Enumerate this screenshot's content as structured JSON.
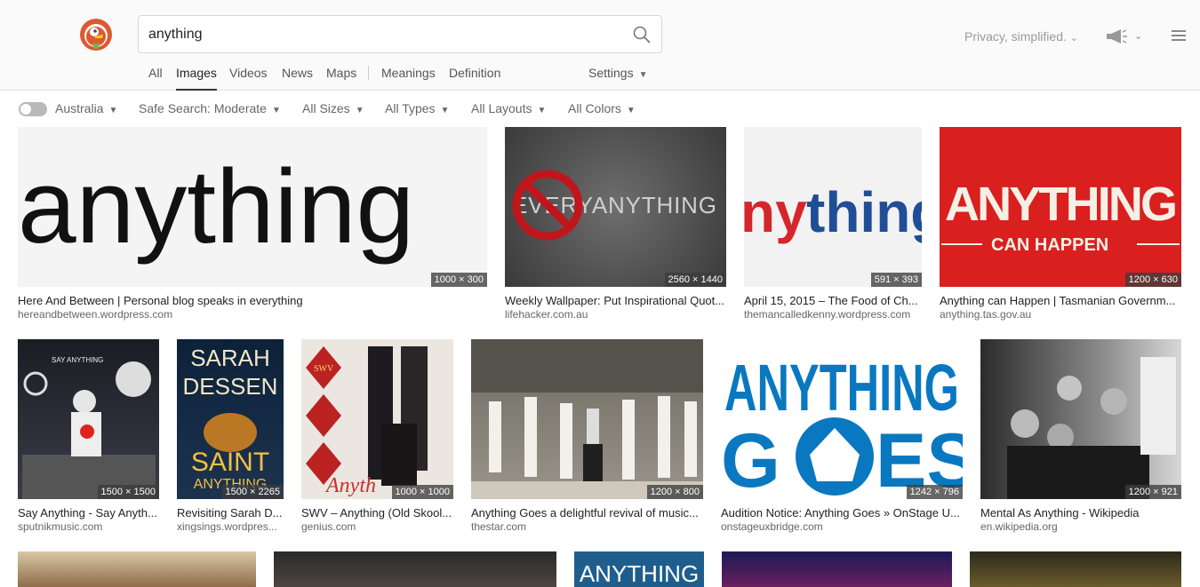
{
  "search": {
    "query": "anything"
  },
  "tabs": [
    "All",
    "Images",
    "Videos",
    "News",
    "Maps",
    "Meanings",
    "Definition"
  ],
  "settings_label": "Settings",
  "tagline": "Privacy, simplified.",
  "filters": {
    "region": "Australia",
    "safe_search": "Safe Search: Moderate",
    "sizes": "All Sizes",
    "types": "All Types",
    "layouts": "All Layouts",
    "colors": "All Colors"
  },
  "results": [
    {
      "title": "Here And Between | Personal blog speaks in everything",
      "source": "hereandbetween.wordpress.com",
      "dims": "1000 × 300",
      "thumb_text": "anything"
    },
    {
      "title": "Weekly Wallpaper: Put Inspirational Quot...",
      "source": "lifehacker.com.au",
      "dims": "2560 × 1440",
      "thumb_text": "EVERYANYTHING"
    },
    {
      "title": "April 15, 2015 – The Food of Ch...",
      "source": "themancalledkenny.wordpress.com",
      "dims": "591 × 393",
      "thumb_text_a": "ny",
      "thumb_text_b": "thing"
    },
    {
      "title": "Anything can Happen | Tasmanian Governm...",
      "source": "anything.tas.gov.au",
      "dims": "1200 × 630",
      "thumb_text_a": "ANYTHING",
      "thumb_text_b": "CAN HAPPEN"
    },
    {
      "title": "Say Anything - Say Anyth...",
      "source": "sputnikmusic.com",
      "dims": "1500 × 1500",
      "thumb_text": "SAY ANYTHING"
    },
    {
      "title": "Revisiting Sarah D...",
      "source": "xingsings.wordpres...",
      "dims": "1500 × 2265",
      "thumb_text_a": "SARAH",
      "thumb_text_b": "DESSEN",
      "thumb_text_c": "SAINT",
      "thumb_text_d": "ANYTHING"
    },
    {
      "title": "SWV – Anything (Old Skool...",
      "source": "genius.com",
      "dims": "1000 × 1000",
      "thumb_text_a": "SWV",
      "thumb_text_b": "Anyth"
    },
    {
      "title": "Anything Goes a delightful revival of music...",
      "source": "thestar.com",
      "dims": "1200 × 800"
    },
    {
      "title": "Audition Notice: Anything Goes » OnStage U...",
      "source": "onstageuxbridge.com",
      "dims": "1242 × 796",
      "thumb_text_a": "ANYTHING",
      "thumb_text_b": "G",
      "thumb_text_c": "ES"
    },
    {
      "title": "Mental As Anything - Wikipedia",
      "source": "en.wikipedia.org",
      "dims": "1200 × 921"
    }
  ],
  "row3_text": "ANYTHING",
  "colors": {
    "accent_red": "#de5833",
    "search_border": "#d5d5d5"
  }
}
